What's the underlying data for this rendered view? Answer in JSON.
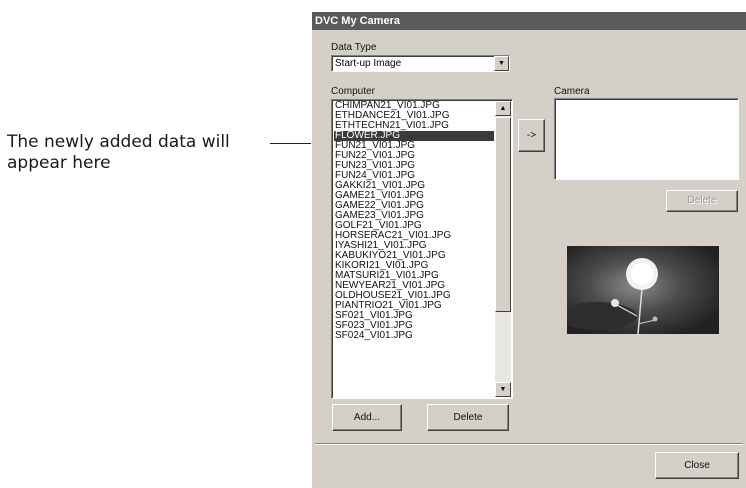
{
  "callout": {
    "line1": "The newly added data will",
    "line2": "appear here"
  },
  "window": {
    "title": "DVC My Camera"
  },
  "data_type": {
    "label": "Data Type",
    "selected": "Start-up Image"
  },
  "computer": {
    "label": "Computer",
    "items": [
      "CHIMPAN21_VI01.JPG",
      "ETHDANCE21_VI01.JPG",
      "ETHTECHN21_VI01.JPG",
      "FLOWER.JPG",
      "FUN21_VI01.JPG",
      "FUN22_VI01.JPG",
      "FUN23_VI01.JPG",
      "FUN24_VI01.JPG",
      "GAKKI21_VI01.JPG",
      "GAME21_VI01.JPG",
      "GAME22_VI01.JPG",
      "GAME23_VI01.JPG",
      "GOLF21_VI01.JPG",
      "HORSERAC21_VI01.JPG",
      "IYASHI21_VI01.JPG",
      "KABUKIYO21_VI01.JPG",
      "KIKORI21_VI01.JPG",
      "MATSURI21_VI01.JPG",
      "NEWYEAR21_VI01.JPG",
      "OLDHOUSE21_VI01.JPG",
      "PIANTRIO21_VI01.JPG",
      "SF021_VI01.JPG",
      "SF023_VI01.JPG",
      "SF024_VI01.JPG"
    ],
    "selected_index": 3
  },
  "camera": {
    "label": "Camera"
  },
  "buttons": {
    "transfer": "->",
    "camera_delete": "Delete",
    "add": "Add...",
    "delete": "Delete",
    "close": "Close"
  },
  "icons": {
    "dropdown": "chevron-down-icon",
    "scroll_up": "arrow-up-icon",
    "scroll_down": "arrow-down-icon"
  }
}
